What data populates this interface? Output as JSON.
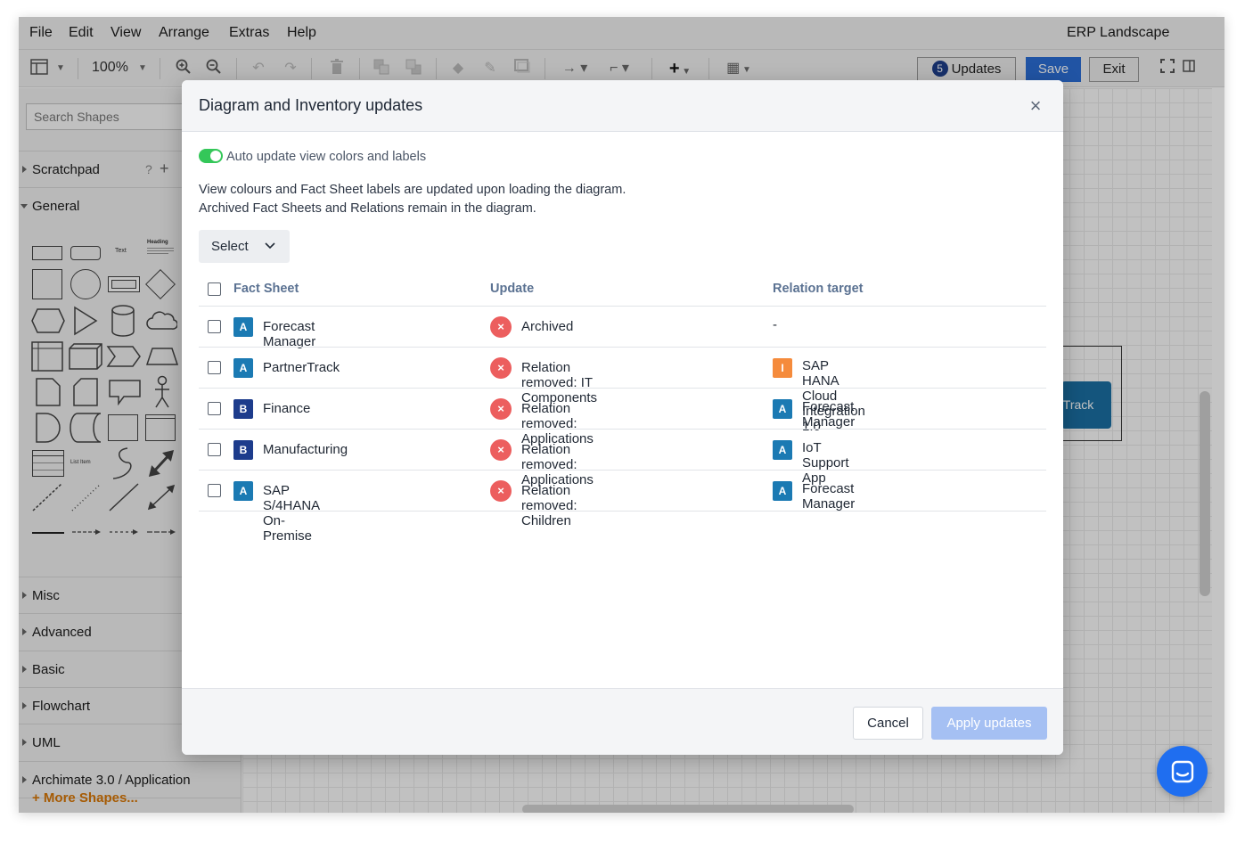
{
  "menubar": {
    "items": [
      "File",
      "Edit",
      "View",
      "Arrange",
      "Extras",
      "Help"
    ],
    "doc_title": "ERP Landscape"
  },
  "toolbar": {
    "zoom": "100%",
    "updates_count": "5",
    "updates_label": "Updates",
    "save_label": "Save",
    "exit_label": "Exit"
  },
  "sidebar": {
    "search_placeholder": "Search Shapes",
    "sections": {
      "scratchpad": "Scratchpad",
      "scratchpad_help": "?",
      "scratchpad_add": "+",
      "general": "General",
      "misc": "Misc",
      "advanced": "Advanced",
      "basic": "Basic",
      "flowchart": "Flowchart",
      "uml": "UML",
      "archimate": "Archimate 3.0 / Application"
    },
    "shape_text_labels": {
      "text": "Text",
      "heading": "Heading",
      "list_item": "List Item"
    },
    "more_shapes": "+ More Shapes..."
  },
  "canvas": {
    "node_label": "uTrack"
  },
  "modal": {
    "title": "Diagram and Inventory updates",
    "close_icon": "×",
    "toggle_label": "Auto update view colors and labels",
    "info_line1": "View colours and Fact Sheet labels are updated upon loading the diagram.",
    "info_line2": "Archived Fact Sheets and Relations remain in the diagram.",
    "select_label": "Select",
    "columns": {
      "fact_sheet": "Fact Sheet",
      "update": "Update",
      "relation_target": "Relation target"
    },
    "rows": [
      {
        "type": "A",
        "type_color": "#1b7ab3",
        "fact_sheet": "Forecast Manager",
        "update": "Archived",
        "target_type": "",
        "target_color": "",
        "target": "-"
      },
      {
        "type": "A",
        "type_color": "#1b7ab3",
        "fact_sheet": "PartnerTrack",
        "update": "Relation removed: IT Components",
        "target_type": "I",
        "target_color": "#f58b3c",
        "target": "SAP HANA Cloud Integration 1.0"
      },
      {
        "type": "B",
        "type_color": "#1d3c8c",
        "fact_sheet": "Finance",
        "update": "Relation removed: Applications",
        "target_type": "A",
        "target_color": "#1b7ab3",
        "target": "Forecast Manager"
      },
      {
        "type": "B",
        "type_color": "#1d3c8c",
        "fact_sheet": "Manufacturing",
        "update": "Relation removed: Applications",
        "target_type": "A",
        "target_color": "#1b7ab3",
        "target": "IoT Support App"
      },
      {
        "type": "A",
        "type_color": "#1b7ab3",
        "fact_sheet": "SAP S/4HANA On-Premise",
        "update": "Relation removed: Children",
        "target_type": "A",
        "target_color": "#1b7ab3",
        "target": "Forecast Manager"
      }
    ],
    "cancel_label": "Cancel",
    "apply_label": "Apply updates",
    "status_icon": "×"
  }
}
